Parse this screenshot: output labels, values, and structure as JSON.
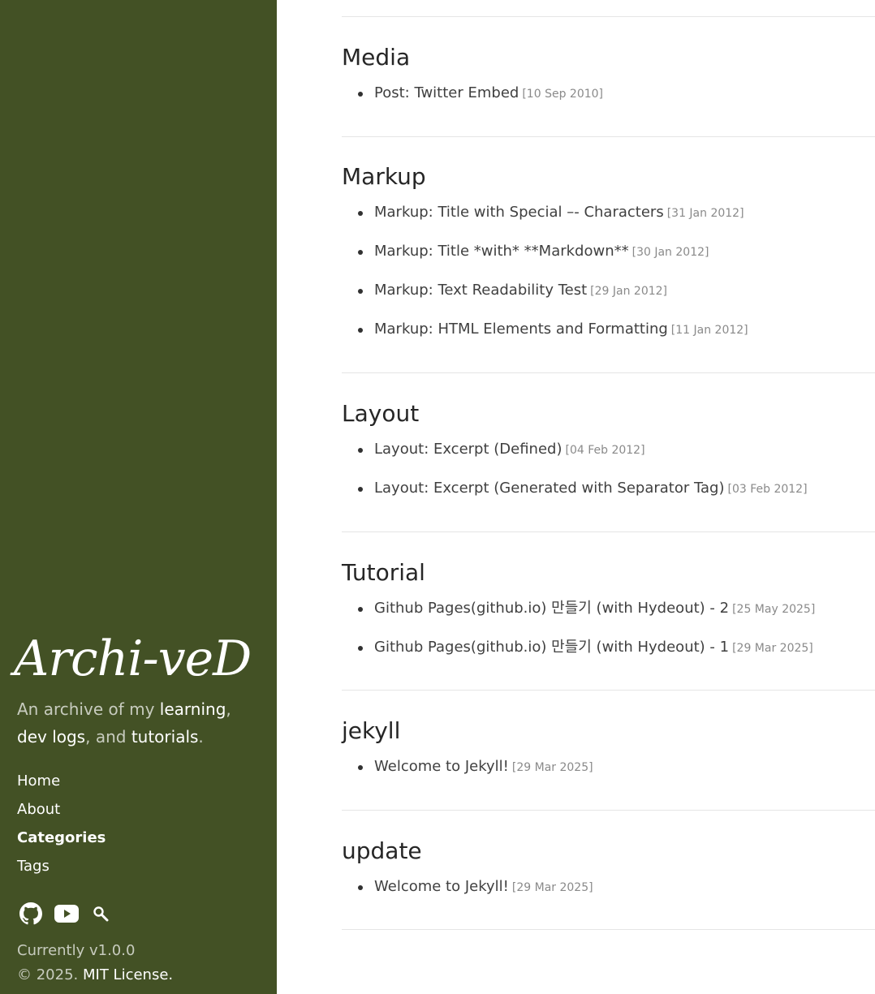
{
  "sidebar": {
    "title": "Archi-veD",
    "lead": {
      "p1": "An archive of my ",
      "w1": "learning",
      "p2": ",",
      "w2": "dev logs",
      "p3": ", and ",
      "w3": "tutorials",
      "p4": "."
    },
    "nav": [
      "Home",
      "About",
      "Categories",
      "Tags"
    ],
    "active_nav": "Categories",
    "social_icons": [
      "github-icon",
      "youtube-icon",
      "search-icon"
    ],
    "version": "Currently v1.0.0",
    "copyright": "© 2025. ",
    "license": "MIT License."
  },
  "sections": [
    {
      "title": "Media",
      "posts": [
        {
          "title": "Post: Twitter Embed",
          "date": "[10 Sep 2010]"
        }
      ]
    },
    {
      "title": "Markup",
      "posts": [
        {
          "title": "Markup: Title with Special –- Characters",
          "date": "[31 Jan 2012]"
        },
        {
          "title": "Markup: Title *with* **Markdown**",
          "date": "[30 Jan 2012]"
        },
        {
          "title": "Markup: Text Readability Test",
          "date": "[29 Jan 2012]"
        },
        {
          "title": "Markup: HTML Elements and Formatting",
          "date": "[11 Jan 2012]"
        }
      ]
    },
    {
      "title": "Layout",
      "posts": [
        {
          "title": "Layout: Excerpt (Defined)",
          "date": "[04 Feb 2012]"
        },
        {
          "title": "Layout: Excerpt (Generated with Separator Tag)",
          "date": "[03 Feb 2012]"
        }
      ]
    },
    {
      "title": "Tutorial",
      "posts": [
        {
          "title": "Github Pages(github.io) 만들기 (with Hydeout) - 2",
          "date": "[25 May 2025]"
        },
        {
          "title": "Github Pages(github.io) 만들기 (with Hydeout) - 1",
          "date": "[29 Mar 2025]"
        }
      ]
    },
    {
      "title": "jekyll",
      "posts": [
        {
          "title": "Welcome to Jekyll!",
          "date": "[29 Mar 2025]"
        }
      ]
    },
    {
      "title": "update",
      "posts": [
        {
          "title": "Welcome to Jekyll!",
          "date": "[29 Mar 2025]"
        }
      ]
    }
  ],
  "colors": {
    "sidebar_bg": "#435125",
    "link": "#404040",
    "date": "#8a8a8a"
  }
}
